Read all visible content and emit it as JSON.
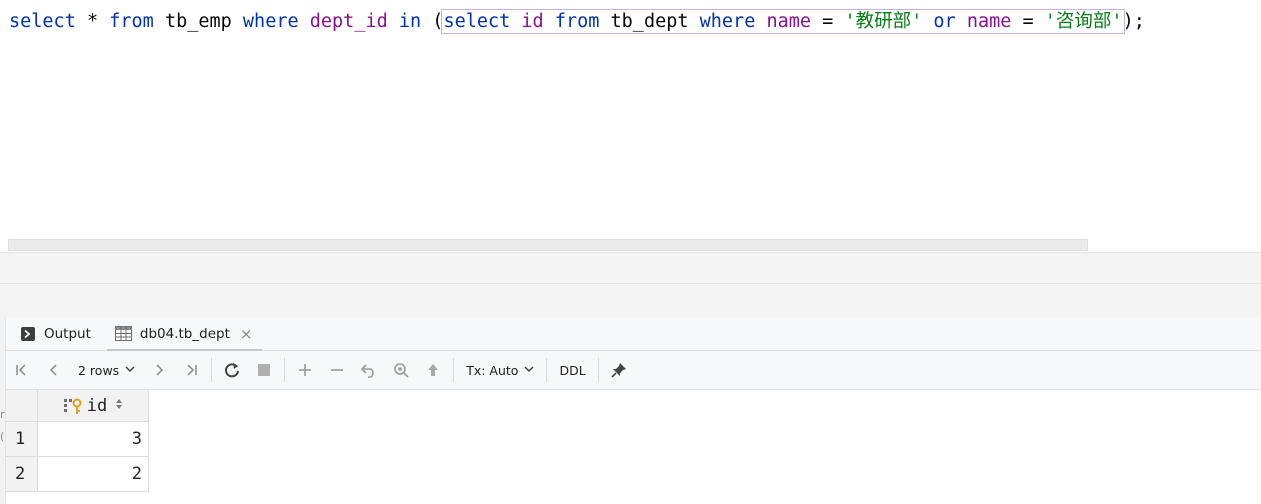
{
  "editor": {
    "query": {
      "t1": "select",
      "t2": " * ",
      "t3": "from",
      "t4": " tb_emp ",
      "t5": "where",
      "t6": " ",
      "t7": "dept_id",
      "t8": " ",
      "t9": "in",
      "t10": " (",
      "t11": "select",
      "t12": " ",
      "t13": "id",
      "t14": " ",
      "t15": "from",
      "t16": " tb_dept ",
      "t17": "where",
      "t18": " ",
      "t19": "name",
      "t20": " = ",
      "t21": "'教研部'",
      "t22": " ",
      "t23": "or",
      "t24": " ",
      "t25": "name",
      "t26": " = ",
      "t27": "'咨询部'",
      "t28": ");"
    }
  },
  "gutter": {
    "frag1": "r",
    "frag2": "("
  },
  "tabs": [
    {
      "label": "Output",
      "icon": "console-icon"
    },
    {
      "label": "db04.tb_dept",
      "icon": "table-icon",
      "close": "×"
    }
  ],
  "toolbar": {
    "rows_label": "2 rows",
    "tx_label": "Tx: Auto",
    "ddl_label": "DDL"
  },
  "grid": {
    "columns": [
      {
        "name": "id",
        "icon": "primary-key-icon"
      }
    ],
    "rows": [
      {
        "num": "1",
        "id": "3"
      },
      {
        "num": "2",
        "id": "2"
      }
    ]
  }
}
